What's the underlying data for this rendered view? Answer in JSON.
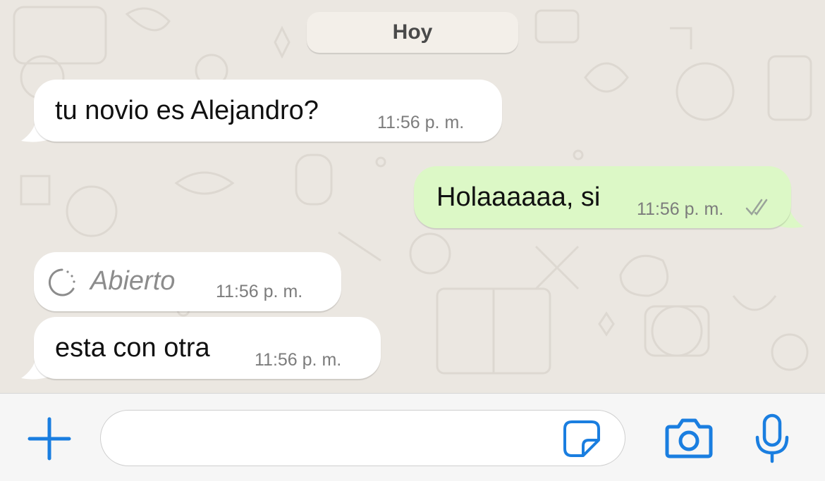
{
  "date_divider": "Hoy",
  "messages": [
    {
      "direction": "incoming",
      "text": "tu novio es Alejandro?",
      "time": "11:56 p. m."
    },
    {
      "direction": "outgoing",
      "text": "Holaaaaaa, si",
      "time": "11:56 p. m.",
      "status": "read-double-check-icon"
    },
    {
      "direction": "incoming",
      "text": "Abierto",
      "time": "11:56 p. m.",
      "kind": "view-once-opened"
    },
    {
      "direction": "incoming",
      "text": "esta con otra",
      "time": "11:56 p. m."
    }
  ],
  "input": {
    "placeholder": "",
    "icons": {
      "attach": "plus-icon",
      "sticker": "sticker-icon",
      "camera": "camera-icon",
      "mic": "microphone-icon"
    }
  },
  "colors": {
    "chat_background": "#ebe7e1",
    "incoming_bubble": "#ffffff",
    "outgoing_bubble": "#dcf8c6",
    "accent_blue": "#1a7ee0",
    "input_bar": "#f6f6f6"
  }
}
